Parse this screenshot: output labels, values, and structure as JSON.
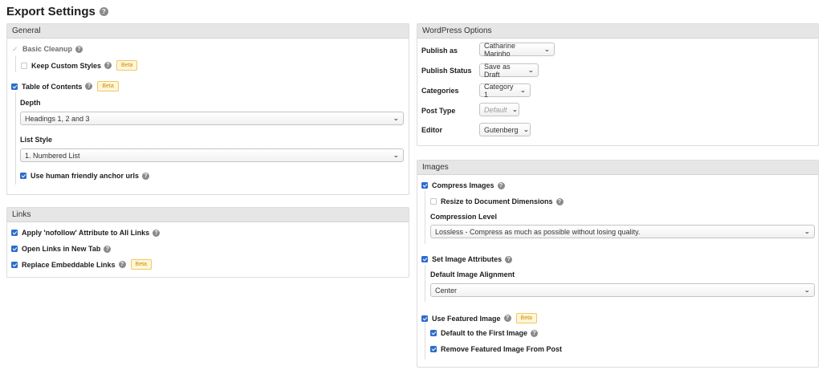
{
  "page": {
    "title": "Export Settings",
    "help": "?"
  },
  "badges": {
    "beta": "Beta"
  },
  "general": {
    "header": "General",
    "basic_cleanup": "Basic Cleanup",
    "keep_custom_styles": "Keep Custom Styles",
    "table_of_contents": "Table of Contents",
    "depth_label": "Depth",
    "depth_value": "Headings 1, 2 and 3",
    "list_style_label": "List Style",
    "list_style_value": "1.  Numbered List",
    "human_anchor": "Use human friendly anchor urls"
  },
  "links": {
    "header": "Links",
    "nofollow": "Apply 'nofollow' Attribute to All Links",
    "new_tab": "Open Links in New Tab",
    "embeddable": "Replace Embeddable Links"
  },
  "wordpress": {
    "header": "WordPress Options",
    "publish_as_label": "Publish as",
    "publish_as_value": "Catharine Marinho",
    "publish_status_label": "Publish Status",
    "publish_status_value": "Save as Draft",
    "categories_label": "Categories",
    "categories_value": "Category 1",
    "post_type_label": "Post Type",
    "post_type_value": "Default",
    "editor_label": "Editor",
    "editor_value": "Gutenberg"
  },
  "images": {
    "header": "Images",
    "compress": "Compress Images",
    "resize": "Resize to Document Dimensions",
    "compression_level_label": "Compression Level",
    "compression_level_value": "Lossless - Compress as much as possible without losing quality.",
    "set_attributes": "Set Image Attributes",
    "alignment_label": "Default Image Alignment",
    "alignment_value": "Center",
    "use_featured": "Use Featured Image",
    "default_first": "Default to the First Image",
    "remove_featured": "Remove Featured Image From Post"
  }
}
